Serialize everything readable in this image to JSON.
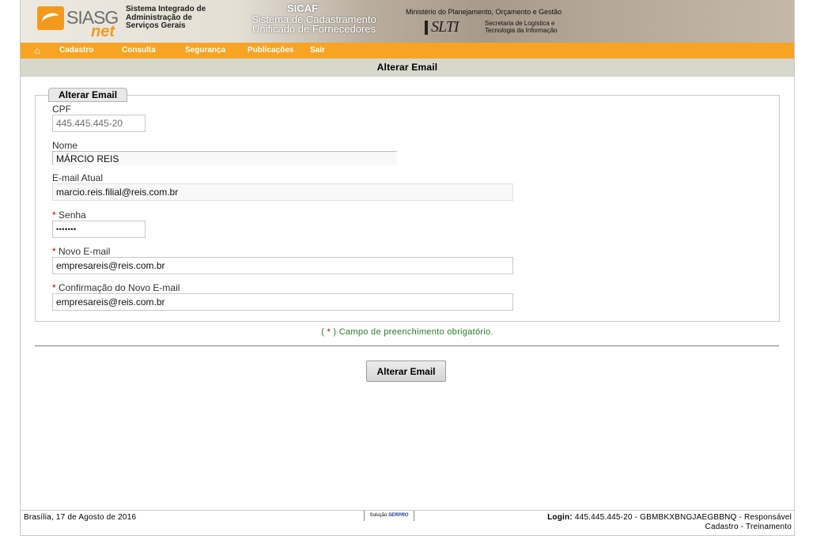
{
  "header": {
    "siasg_logo": "SIASG",
    "siasg_net": "net",
    "siasg_desc": [
      "Sistema Integrado de",
      "Administração de",
      "Serviços Gerais"
    ],
    "sicaf_title": "SICAF",
    "sicaf_subtitle": [
      "Sistema de Cadastramento",
      "Unificado de Fornecedores"
    ],
    "ministerio": "Ministério do Planejamento, Orçamento e Gestão",
    "slti_logo": "SLTI",
    "slti_desc": [
      "Secretaria de Logística e",
      "Tecnologia da Informação"
    ]
  },
  "menu": {
    "home_icon": "home-icon",
    "items": [
      "Cadastro",
      "Consulta",
      "Segurança",
      "Publicações",
      "Sair"
    ]
  },
  "page": {
    "title": "Alterar Email",
    "legend": "Alterar Email"
  },
  "form": {
    "cpf_label": "CPF",
    "cpf_value": "445.445.445-20",
    "nome_label": "Nome",
    "nome_value": "MÁRCIO REIS",
    "email_atual_label": "E-mail Atual",
    "email_atual_value": "marcio.reis.filial@reis.com.br",
    "required_mark": "*",
    "senha_label": "Senha",
    "senha_value": "•••••••",
    "novo_email_label": "Novo E-mail",
    "novo_email_value": "empresareis@reis.com.br",
    "confirm_label": "Confirmação do Novo E-mail",
    "confirm_value": "empresareis@reis.com.br"
  },
  "note": {
    "open": "(",
    "mark": "*",
    "text": ") Campo de preenchimento obrigatório."
  },
  "submit_label": "Alterar Email",
  "footer": {
    "date": "Brasília, 17 de Agosto de 2016",
    "serpro_prefix": "Solução",
    "serpro_logo": "SERPRO",
    "login_label": "Login:",
    "login_value": "445.445.445-20 - GBMBKXBNGJAEGBBNQ - Responsável",
    "login_line2": "Cadastro - Treinamento"
  },
  "colors": {
    "menu_bg": "#f7a425",
    "title_bg": "#d7d7cc",
    "required": "#cc0000",
    "note_text": "#2a7a2a"
  }
}
